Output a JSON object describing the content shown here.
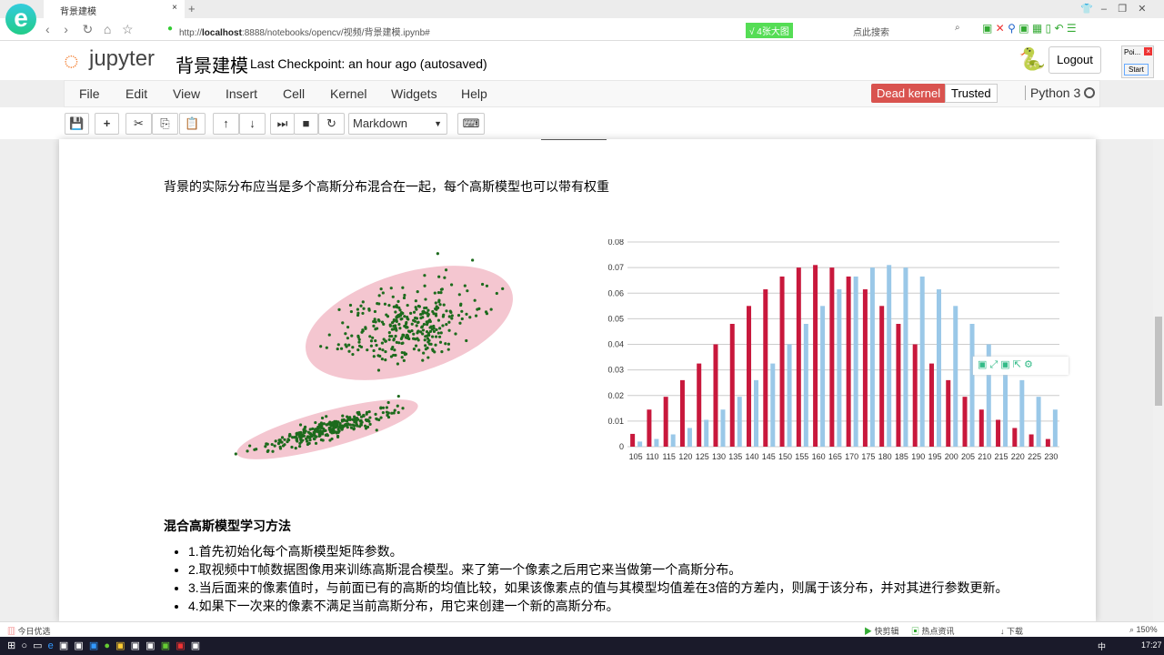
{
  "browser": {
    "tab_title": "背景建模",
    "new_tab": "+",
    "url_prefix": "http://",
    "url_host": "localhost",
    "url_rest": ":8888/notebooks/opencv/视频/背景建模.ipynb#",
    "promo": "√ 4张大图",
    "search_placeholder": "点此搜索",
    "popup_label": "Poi...",
    "popup_start": "Start"
  },
  "jupyter": {
    "brand": "jupyter",
    "title": "背景建模",
    "checkpoint": "Last Checkpoint: an hour ago (autosaved)",
    "logout": "Logout",
    "menu": [
      "File",
      "Edit",
      "View",
      "Insert",
      "Cell",
      "Kernel",
      "Widgets",
      "Help"
    ],
    "dead_kernel": "Dead kernel",
    "trusted": "Trusted",
    "kernel_name": "Python 3",
    "cell_type": "Markdown"
  },
  "content": {
    "intro": "背景的实际分布应当是多个高斯分布混合在一起，每个高斯模型也可以带有权重",
    "heading": "混合高斯模型学习方法",
    "items": [
      "1.首先初始化每个高斯模型矩阵参数。",
      "2.取视频中T帧数据图像用来训练高斯混合模型。来了第一个像素之后用它来当做第一个高斯分布。",
      "3.当后面来的像素值时，与前面已有的高斯的均值比较，如果该像素点的值与其模型均值差在3倍的方差内，则属于该分布，并对其进行参数更新。",
      "4.如果下一次来的像素不满足当前高斯分布，用它来创建一个新的高斯分布。"
    ]
  },
  "status": {
    "left": "今日优选",
    "quick": "快剪辑",
    "hot": "热点资讯",
    "download": "下载",
    "zoom": "150%"
  },
  "taskbar": {
    "time": "17:27",
    "ime": "中"
  },
  "chart_data": {
    "type": "bar",
    "categories": [
      "105",
      "110",
      "115",
      "120",
      "125",
      "130",
      "135",
      "140",
      "145",
      "150",
      "155",
      "160",
      "165",
      "170",
      "175",
      "180",
      "185",
      "190",
      "195",
      "200",
      "205",
      "210",
      "215",
      "220",
      "225",
      "230"
    ],
    "yticks": [
      "0",
      "0.01",
      "0.02",
      "0.03",
      "0.04",
      "0.05",
      "0.06",
      "0.07",
      "0.08"
    ],
    "ylim": [
      0,
      0.08
    ],
    "series": [
      {
        "name": "red",
        "color": "#c8183c",
        "values": [
          0.005,
          0.0145,
          0.0195,
          0.026,
          0.0325,
          0.04,
          0.048,
          0.055,
          0.0615,
          0.0665,
          0.07,
          0.071,
          0.07,
          0.0665,
          0.0615,
          0.055,
          0.048,
          0.04,
          0.0325,
          0.026,
          0.0195,
          0.0145,
          0.0105,
          0.0073,
          0.0048,
          0.003
        ]
      },
      {
        "name": "blue",
        "color": "#9ac8e8",
        "values": [
          0.002,
          0.003,
          0.0048,
          0.0073,
          0.0105,
          0.0145,
          0.0195,
          0.026,
          0.0325,
          0.04,
          0.048,
          0.055,
          0.0615,
          0.0665,
          0.07,
          0.071,
          0.07,
          0.0665,
          0.0615,
          0.055,
          0.048,
          0.04,
          0.0325,
          0.026,
          0.0195,
          0.0145
        ]
      }
    ]
  }
}
